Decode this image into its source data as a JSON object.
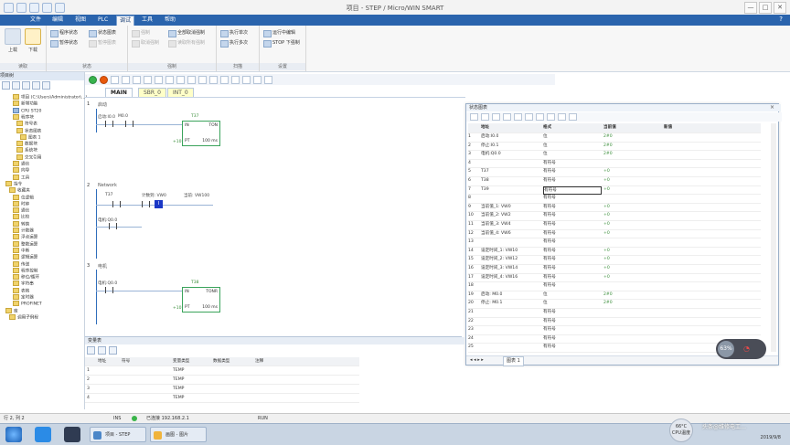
{
  "window": {
    "title": "项目 - STEP / Micro/WIN SMART",
    "controls": [
      "—",
      "□",
      "✕"
    ]
  },
  "menu": {
    "tabs": [
      "文件",
      "编辑",
      "视图",
      "PLC",
      "调试",
      "工具",
      "帮助"
    ],
    "active_index": 4,
    "help": "?"
  },
  "ribbon": {
    "groups": [
      {
        "title": "读取",
        "buttons": [
          "上载",
          "下载"
        ]
      },
      {
        "title": "状态",
        "buttons": [
          "程序状态",
          "状态图表",
          "暂停状态",
          "暂停图表"
        ]
      },
      {
        "title": "强制",
        "buttons": [
          "强制",
          "取消强制",
          "全部取消强制",
          "读取所有强制"
        ]
      },
      {
        "title": "扫描",
        "buttons": [
          "执行单次",
          "执行多次"
        ]
      },
      {
        "title": "设置",
        "buttons": [
          "运行中编辑",
          "STOP 下强制"
        ]
      }
    ]
  },
  "left_panel": {
    "header": "项目树",
    "tree": [
      "项目 (C:\\Users\\Administrator\\...)",
      "新增功能",
      "CPU ST20",
      "程序块",
      "符号表",
      "状态图表",
      "图表 1",
      "数据块",
      "系统块",
      "交叉引用",
      "通信",
      "向导",
      "工具",
      "指令",
      "收藏夹",
      "位逻辑",
      "时钟",
      "通信",
      "比较",
      "转换",
      "计数器",
      "浮点运算",
      "整数运算",
      "中断",
      "逻辑运算",
      "传送",
      "程序控制",
      "移位/循环",
      "字符串",
      "表格",
      "定时器",
      "PROFINET",
      "库",
      "调用子例程"
    ]
  },
  "editor": {
    "tabs": [
      "MAIN",
      "SBR_0",
      "INT_0"
    ],
    "networks": [
      {
        "num": "1",
        "comment": "启动",
        "contacts": [
          "启动:I0.0",
          "M0.0"
        ],
        "timer": {
          "name": "T37",
          "in": "IN",
          "type": "TON",
          "pt_label": "PT",
          "pt_value": "+10",
          "ms": "100 ms"
        }
      },
      {
        "num": "2",
        "comment": "Network",
        "contacts": [
          "T37",
          "计数到: VW0",
          "I",
          "当前: VW100",
          "电机:Q0.0"
        ],
        "values": [
          "+1",
          "T37",
          "+1"
        ]
      },
      {
        "num": "3",
        "comment": "电机",
        "contacts": [
          "电机:Q0.0"
        ],
        "timer": {
          "name": "T38",
          "in": "IN",
          "type": "TONR",
          "pt_label": "PT",
          "pt_value": "+10",
          "ms": "100 ms"
        }
      }
    ]
  },
  "status_chart": {
    "title": "状态图表",
    "close": "×",
    "columns": [
      "地址",
      "格式",
      "当前值",
      "新值"
    ],
    "rows": [
      {
        "n": "1",
        "addr": "启动:I0.0",
        "fmt": "位",
        "val": "2#0"
      },
      {
        "n": "2",
        "addr": "停止:I0.1",
        "fmt": "位",
        "val": "2#0"
      },
      {
        "n": "3",
        "addr": "电机:Q0.0",
        "fmt": "位",
        "val": "2#0"
      },
      {
        "n": "4",
        "addr": "",
        "fmt": "有符号",
        "val": ""
      },
      {
        "n": "5",
        "addr": "T37",
        "fmt": "有符号",
        "val": "+0"
      },
      {
        "n": "6",
        "addr": "T38",
        "fmt": "有符号",
        "val": "+0"
      },
      {
        "n": "7",
        "addr": "T39",
        "fmt": "有符号",
        "val": "+0"
      },
      {
        "n": "8",
        "addr": "",
        "fmt": "有符号",
        "val": ""
      },
      {
        "n": "9",
        "addr": "当前值_1: VW0",
        "fmt": "有符号",
        "val": "+0"
      },
      {
        "n": "10",
        "addr": "当前值_2: VW2",
        "fmt": "有符号",
        "val": "+0"
      },
      {
        "n": "11",
        "addr": "当前值_3: VW4",
        "fmt": "有符号",
        "val": "+0"
      },
      {
        "n": "12",
        "addr": "当前值_4: VW6",
        "fmt": "有符号",
        "val": "+0"
      },
      {
        "n": "13",
        "addr": "",
        "fmt": "有符号",
        "val": ""
      },
      {
        "n": "14",
        "addr": "设定时间_1: VW10",
        "fmt": "有符号",
        "val": "+0"
      },
      {
        "n": "15",
        "addr": "设定时间_2: VW12",
        "fmt": "有符号",
        "val": "+0"
      },
      {
        "n": "16",
        "addr": "设定时间_3: VW14",
        "fmt": "有符号",
        "val": "+0"
      },
      {
        "n": "17",
        "addr": "设定时间_4: VW16",
        "fmt": "有符号",
        "val": "+0"
      },
      {
        "n": "18",
        "addr": "",
        "fmt": "有符号",
        "val": ""
      },
      {
        "n": "19",
        "addr": "启动: M0.0",
        "fmt": "位",
        "val": "2#0"
      },
      {
        "n": "20",
        "addr": "停止: M0.1",
        "fmt": "位",
        "val": "2#0"
      },
      {
        "n": "21",
        "addr": "",
        "fmt": "有符号",
        "val": ""
      },
      {
        "n": "22",
        "addr": "",
        "fmt": "有符号",
        "val": ""
      },
      {
        "n": "23",
        "addr": "",
        "fmt": "有符号",
        "val": ""
      },
      {
        "n": "24",
        "addr": "",
        "fmt": "有符号",
        "val": ""
      },
      {
        "n": "25",
        "addr": "",
        "fmt": "有符号",
        "val": ""
      }
    ],
    "bottom_tab": "图表 1"
  },
  "bottom_panel": {
    "title": "变量表",
    "columns": [
      "地址",
      "符号",
      "变量类型",
      "数据类型",
      "注释"
    ],
    "rows": [
      {
        "n": "1",
        "type": "TEMP"
      },
      {
        "n": "2",
        "type": "TEMP"
      },
      {
        "n": "3",
        "type": "TEMP"
      },
      {
        "n": "4",
        "type": "TEMP"
      }
    ]
  },
  "statusbar": {
    "position": "行 2, 列 2",
    "mode": "INS",
    "connection": "已连接 192.168.2.1",
    "run": "RUN"
  },
  "taskbar": {
    "tasks": [
      "项目 - STEP",
      "画图 - 图片"
    ],
    "time": "2019/9/8",
    "cpu_temp": "66°C",
    "cpu_label": "CPU温度"
  },
  "widgets": {
    "net_pct": "63%",
    "watermark": "头条@维修电工…"
  }
}
